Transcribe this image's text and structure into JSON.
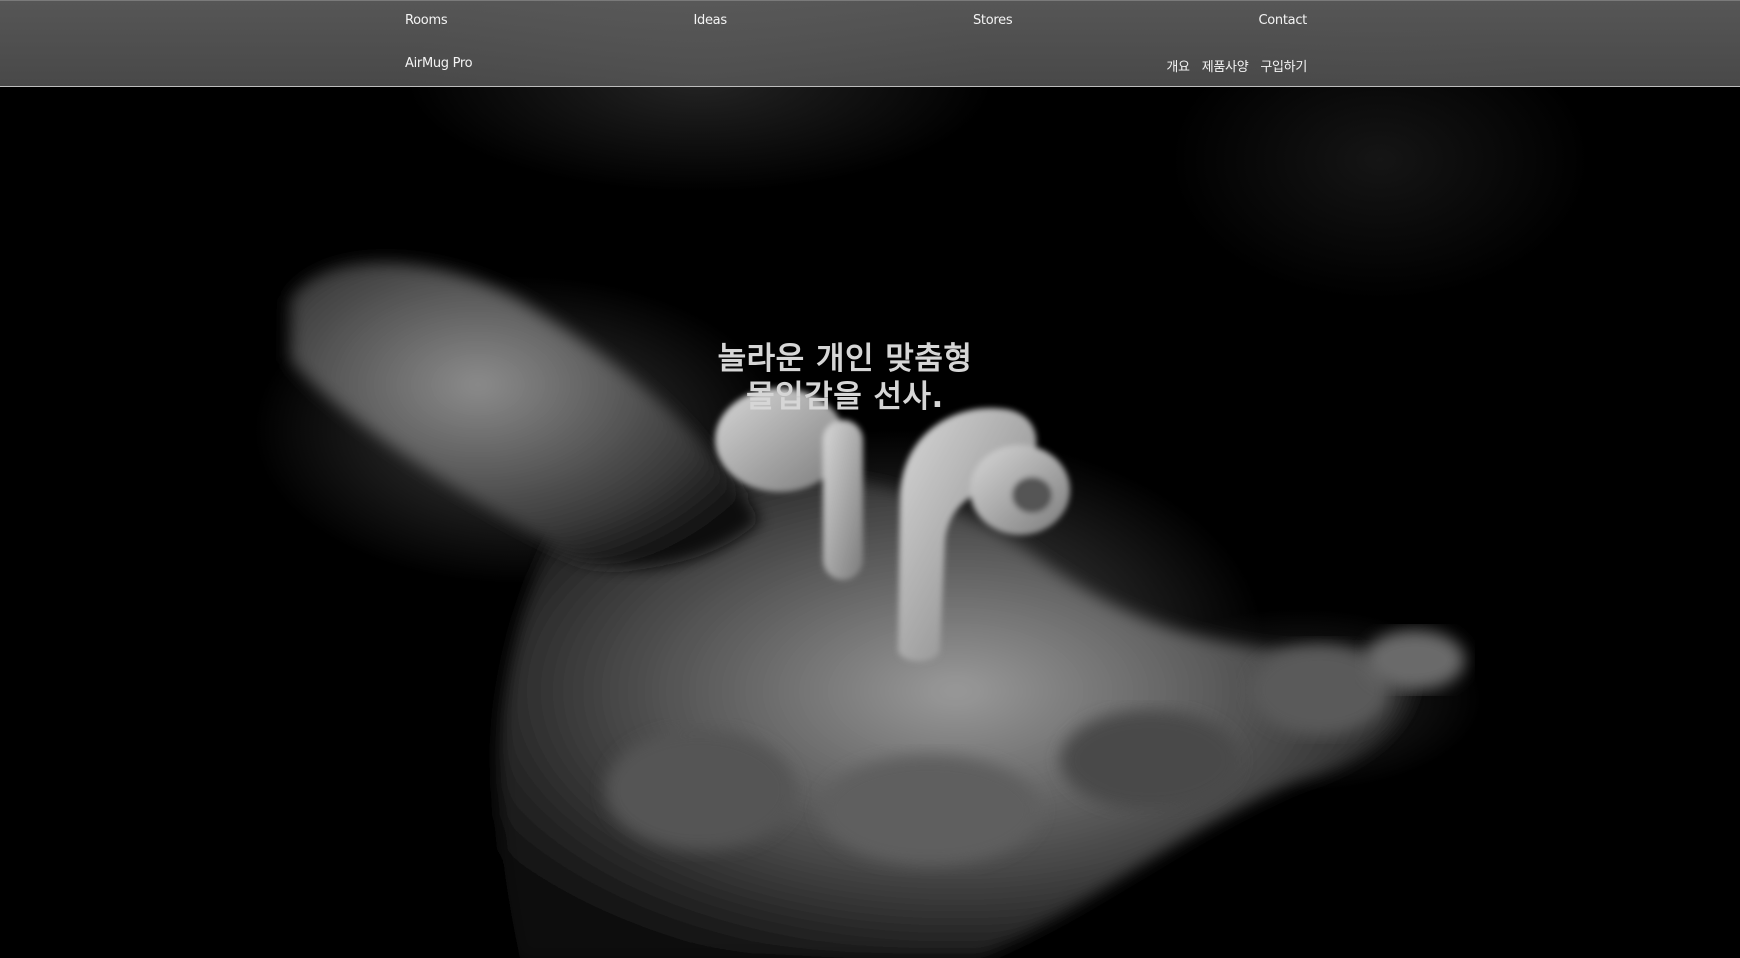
{
  "nav": {
    "links": [
      "Rooms",
      "Ideas",
      "Stores",
      "Contact"
    ]
  },
  "product_bar": {
    "brand": "AirMug Pro",
    "links": [
      "개요",
      "제품사양",
      "구입하기"
    ]
  },
  "hero": {
    "headline_line1": "놀라운 개인 맞춤형",
    "headline_line2": "몰입감을 선사."
  }
}
